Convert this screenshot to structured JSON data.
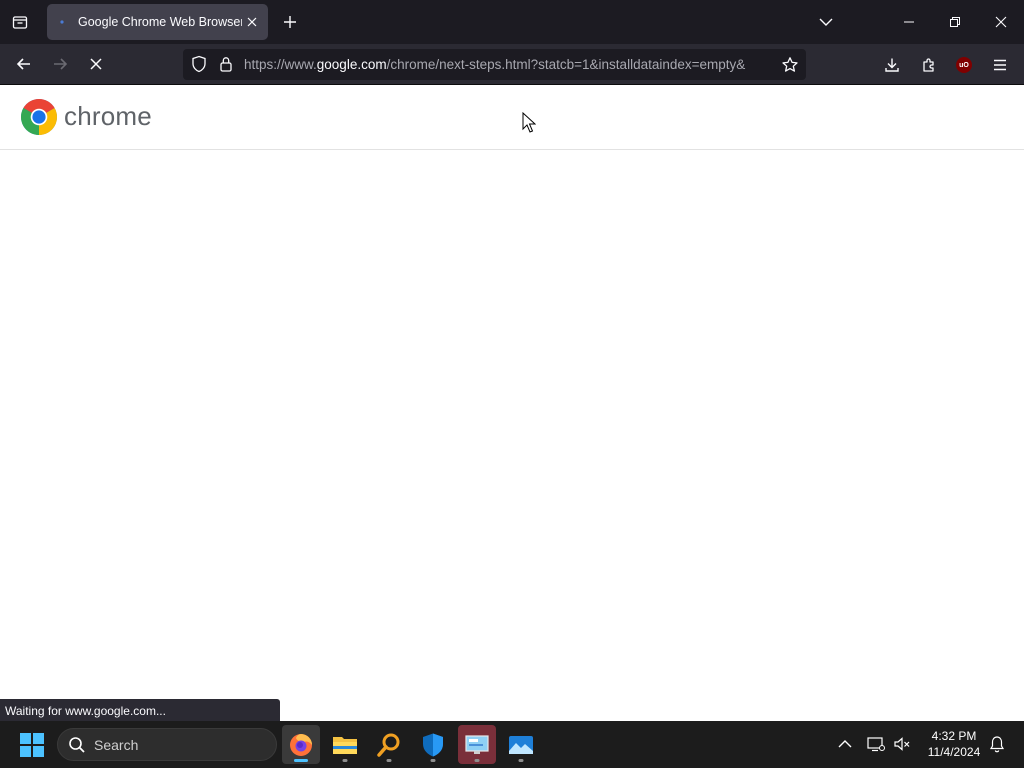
{
  "browser": {
    "tab": {
      "title": "Google Chrome Web Browser"
    },
    "url": {
      "prefix": "https://www.",
      "domain": "google.com",
      "path": "/chrome/next-steps.html?statcb=1&installdataindex=empty&"
    },
    "status_text": "Waiting for www.google.com...",
    "extension_badge": "uO"
  },
  "page": {
    "logo_text": "chrome",
    "colors": {
      "red": "#ea4335",
      "yellow": "#fbbc04",
      "green": "#34a853",
      "blue": "#1a73e8"
    }
  },
  "taskbar": {
    "search_label": "Search",
    "clock": {
      "time": "4:32 PM",
      "date": "11/4/2024"
    }
  }
}
